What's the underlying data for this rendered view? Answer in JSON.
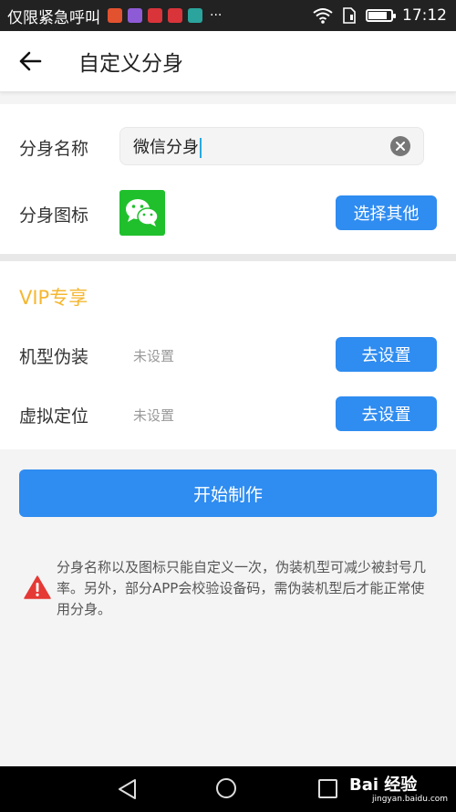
{
  "status_bar": {
    "carrier": "仅限紧急呼叫",
    "more": "···",
    "time": "17:12",
    "battery_level": 0.85,
    "icons": [
      "notif-app-1-icon",
      "notif-app-2-icon",
      "notif-app-3-icon",
      "notif-app-4-icon",
      "notif-app-5-icon"
    ],
    "icon_colors": [
      "#e2522f",
      "#8e5bd6",
      "#d8343a",
      "#d8343a",
      "#2aa49c"
    ]
  },
  "header": {
    "title": "自定义分身",
    "back_icon": "arrow-left-icon"
  },
  "clone_name": {
    "label": "分身名称",
    "value": "微信分身",
    "clear_icon": "clear-icon"
  },
  "clone_icon": {
    "label": "分身图标",
    "icon": "wechat-icon",
    "button": "选择其他"
  },
  "vip": {
    "title": "VIP专享",
    "rows": [
      {
        "label": "机型伪装",
        "value": "未设置",
        "button": "去设置"
      },
      {
        "label": "虚拟定位",
        "value": "未设置",
        "button": "去设置"
      }
    ]
  },
  "start_button": "开始制作",
  "notice": {
    "icon": "warning-icon",
    "text": "分身名称以及图标只能自定义一次，伪装机型可减少被封号几率。另外，部分APP会校验设备码，需伪装机型后才能正常使用分身。"
  },
  "watermark": {
    "logo": "Bai 经验",
    "url": "jingyan.baidu.com"
  },
  "colors": {
    "accent": "#2f8cf0",
    "vip": "#f5b731",
    "wechat": "#1fc02c",
    "warning": "#e53935"
  }
}
